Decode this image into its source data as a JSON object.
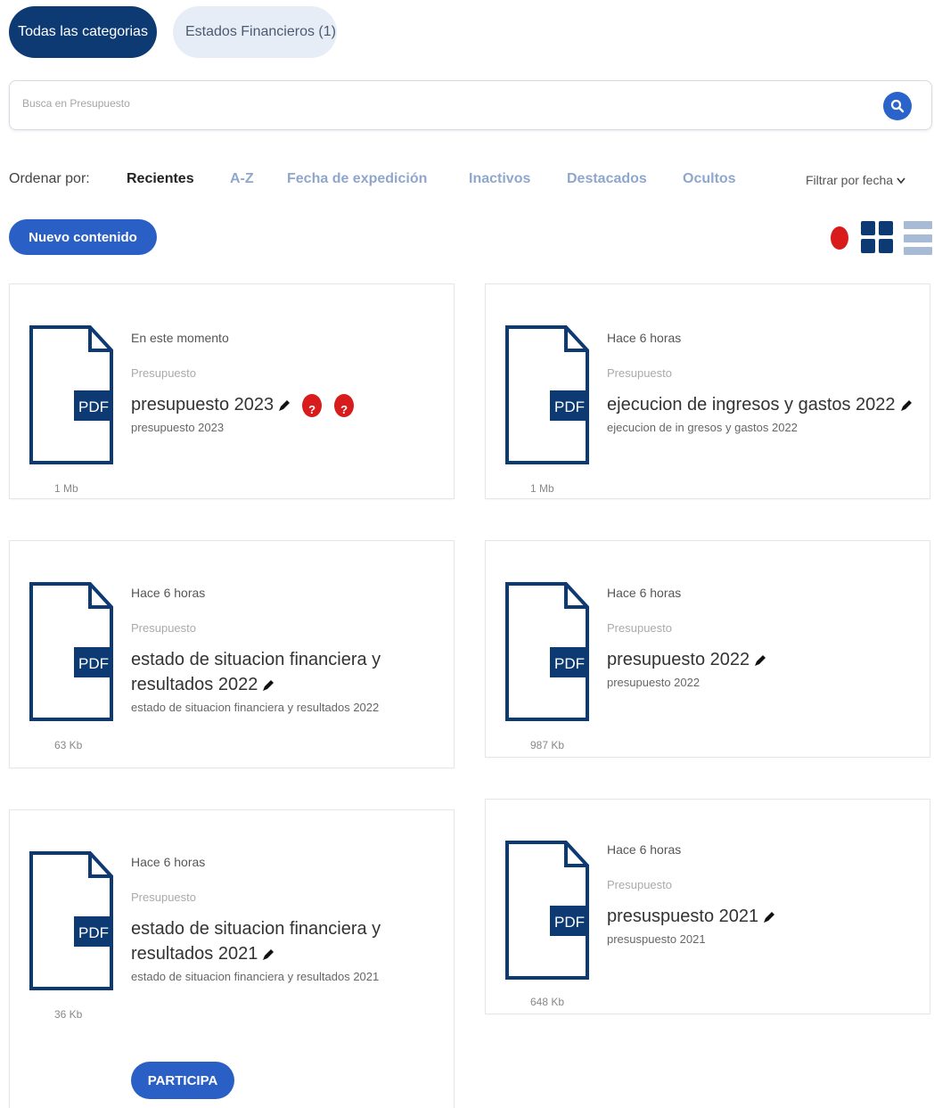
{
  "categories": {
    "all_label": "Todas las categorias",
    "financial_label": "Estados Financieros (1)"
  },
  "search": {
    "placeholder": "Busca en Presupuesto"
  },
  "sort": {
    "label": "Ordenar por:",
    "options": [
      "Recientes",
      "A-Z",
      "Fecha de expedición",
      "Inactivos",
      "Destacados",
      "Ocultos"
    ],
    "active": "Recientes",
    "filter_date_label": "Filtrar por fecha"
  },
  "new_content_label": "Nuevo contenido",
  "colors": {
    "primary": "#0e3a73",
    "accent": "#2a5fc6",
    "alert": "#d81c1c",
    "link": "#8fa7cd"
  },
  "file_icon_label": "PDF",
  "cards": [
    {
      "time": "En este momento",
      "category": "Presupuesto",
      "title": "presupuesto 2023",
      "description": "presupuesto 2023",
      "size": "1 Mb"
    },
    {
      "time": "Hace 6 horas",
      "category": "Presupuesto",
      "title": "ejecucion de ingresos y gastos 2022",
      "description": "ejecucion de in gresos y gastos 2022",
      "size": "1 Mb"
    },
    {
      "time": "Hace 6 horas",
      "category": "Presupuesto",
      "title": "estado de situacion financiera y resultados 2022",
      "description": "estado de situacion financiera y resultados 2022",
      "size": "63 Kb"
    },
    {
      "time": "Hace 6 horas",
      "category": "Presupuesto",
      "title": "presupuesto 2022",
      "description": "presupuesto 2022",
      "size": "987 Kb"
    },
    {
      "time": "Hace 6 horas",
      "category": "Presupuesto",
      "title": "estado de situacion financiera y resultados 2021",
      "description": "estado de situacion financiera y resultados 2021",
      "size": "36 Kb",
      "action_label": "PARTICIPA"
    },
    {
      "time": "Hace 6 horas",
      "category": "Presupuesto",
      "title": "presuspuesto 2021",
      "description": "presuspuesto 2021",
      "size": "648 Kb"
    }
  ]
}
